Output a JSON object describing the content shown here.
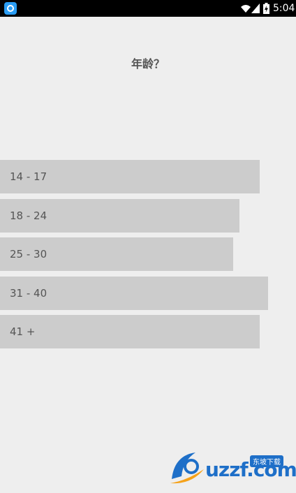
{
  "status_bar": {
    "time": "5:04",
    "icons": [
      "app-icon",
      "wifi-icon",
      "signal-icon",
      "battery-charging-icon"
    ]
  },
  "question": {
    "text": "年龄？"
  },
  "options": [
    {
      "label": "14 - 17"
    },
    {
      "label": "18 - 24"
    },
    {
      "label": "25 - 30"
    },
    {
      "label": "31 - 40"
    },
    {
      "label": "41 +"
    }
  ],
  "colors": {
    "background": "#eeeeee",
    "option_background": "#cccccc",
    "text": "#555555",
    "status_bar": "#000000"
  },
  "watermark": {
    "text": "uzzf.com",
    "tag": "东坡下载"
  }
}
